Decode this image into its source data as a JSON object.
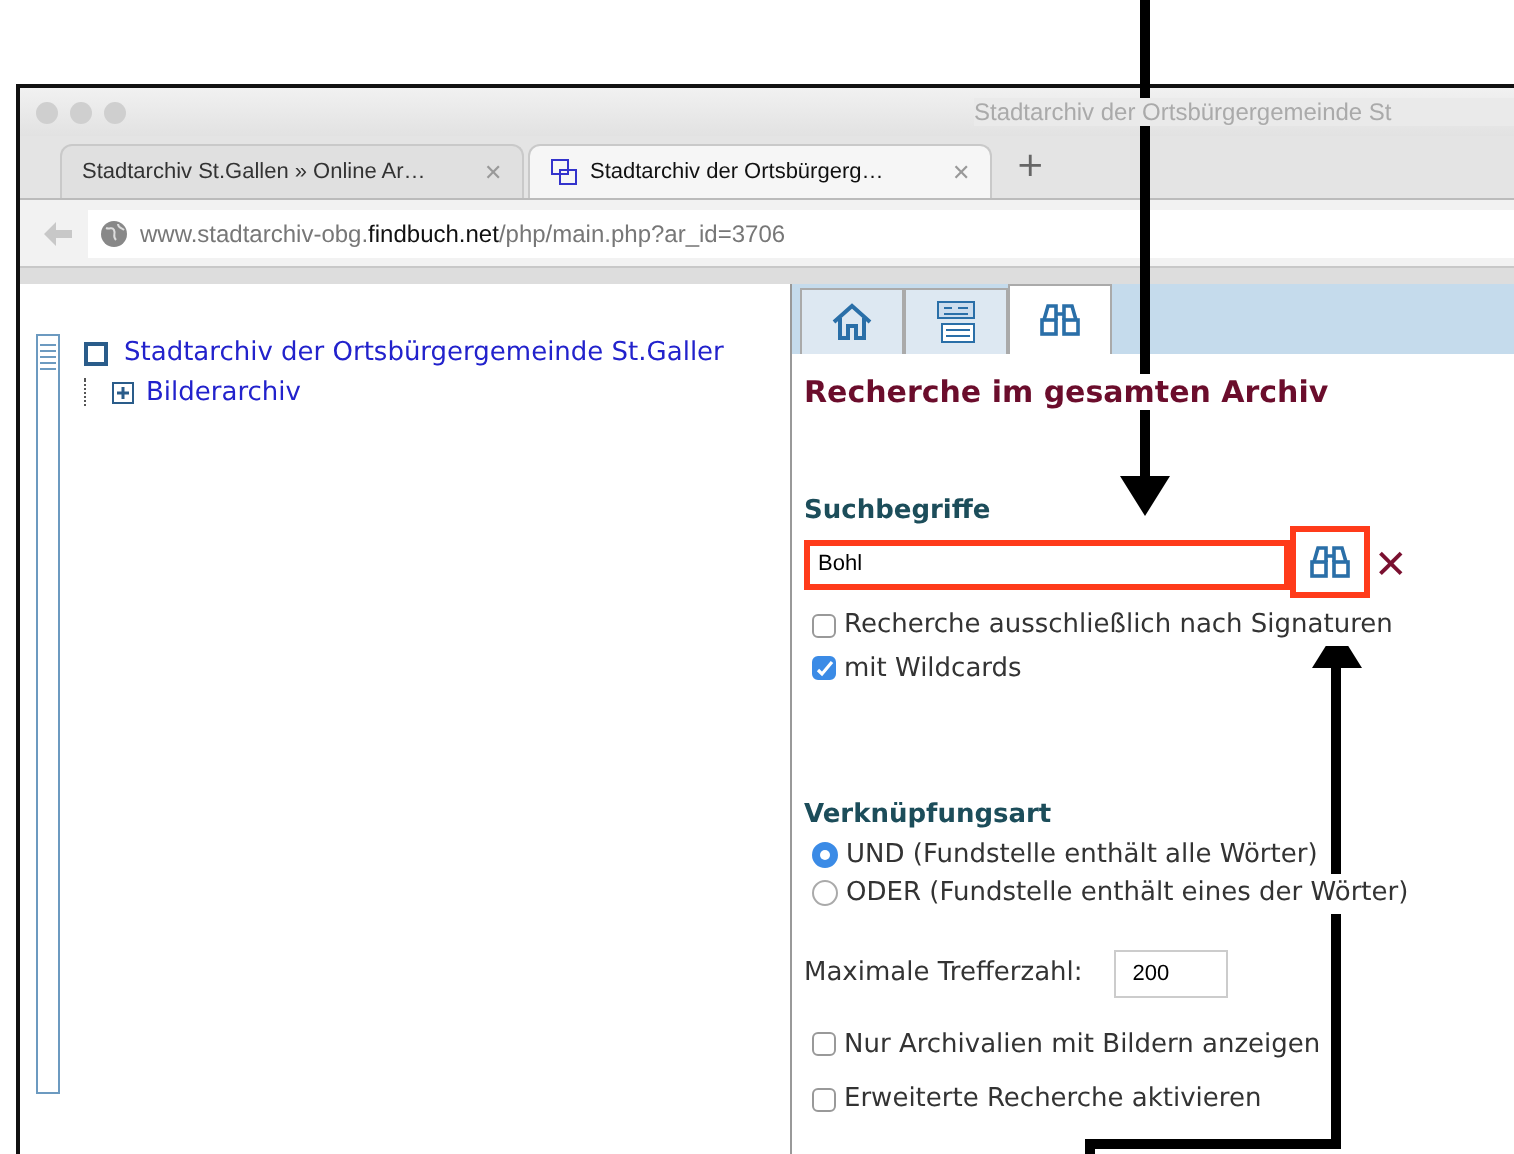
{
  "window": {
    "title": "Stadtarchiv der Ortsbürgergemeinde St"
  },
  "browser_tabs": [
    {
      "label": "Stadtarchiv St.Gallen » Online Ar…",
      "selected": false,
      "close": "✕"
    },
    {
      "label": "Stadtarchiv der Ortsbürgerg…",
      "selected": true,
      "close": "✕"
    }
  ],
  "new_tab": "+",
  "address": {
    "prefix": "www.stadtarchiv-obg.",
    "domain": "findbuch.net",
    "path": "/php/main.php?ar_id=3706"
  },
  "tree": [
    {
      "label": "Stadtarchiv der Ortsbürgergemeinde St.Galler",
      "children": [
        {
          "label": "Bilderarchiv",
          "expanded": false
        }
      ]
    }
  ],
  "panel": {
    "tabs": [
      {
        "kind": "home",
        "selected": false
      },
      {
        "kind": "catalog",
        "selected": false
      },
      {
        "kind": "search",
        "selected": true
      }
    ],
    "heading": "Recherche im gesamten Archiv",
    "search_label": "Suchbegriffe",
    "search_value": "Bohl",
    "clear": "✕",
    "options": [
      {
        "label": "Recherche ausschließlich nach Signaturen",
        "checked": false
      },
      {
        "label": "mit Wildcards",
        "checked": true
      }
    ],
    "link_type_label": "Verknüpfungsart",
    "link_types": [
      {
        "label": "UND (Fundstelle enthält alle Wörter)",
        "selected": true
      },
      {
        "label": "ODER (Fundstelle enthält eines der Wörter)",
        "selected": false
      }
    ],
    "max_hits_label": "Maximale Trefferzahl:",
    "max_hits_value": "200",
    "extra_options": [
      {
        "label": "Nur Archivalien mit Bildern anzeigen",
        "checked": false
      },
      {
        "label": "Erweiterte Recherche aktivieren",
        "checked": false
      }
    ]
  }
}
